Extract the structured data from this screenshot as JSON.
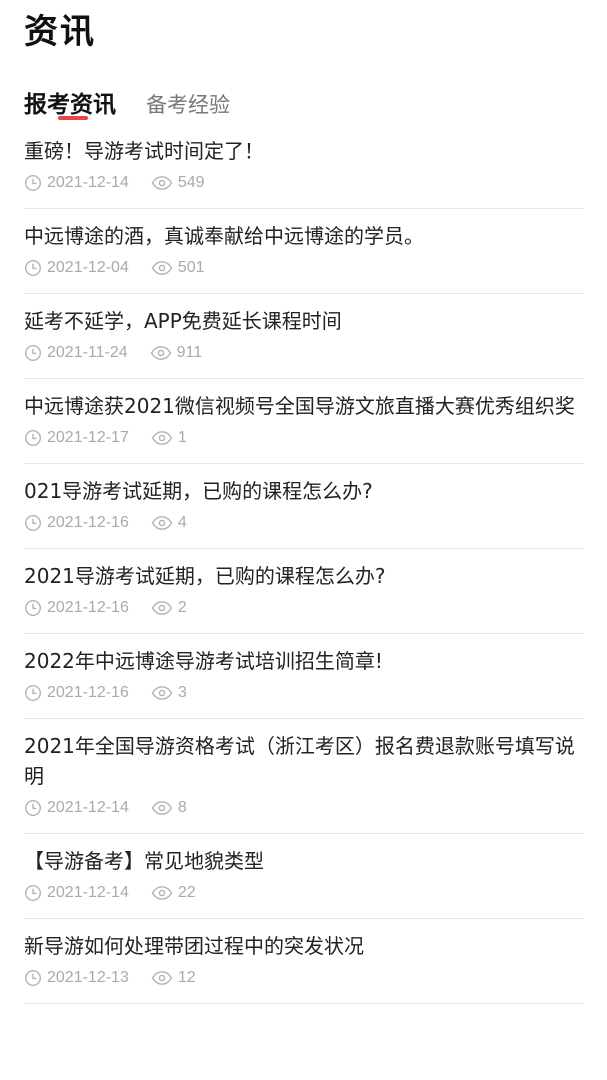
{
  "header": {
    "title": "资讯"
  },
  "tabs": [
    {
      "label": "报考资讯",
      "active": true
    },
    {
      "label": "备考经验",
      "active": false
    }
  ],
  "colors": {
    "accent": "#e8464a",
    "meta_text": "#aaaaaa",
    "divider": "#e8e8e8"
  },
  "icons": {
    "date": "clock-icon",
    "views": "eye-icon"
  },
  "news": [
    {
      "title": "重磅！导游考试时间定了！",
      "date": "2021-12-14",
      "views": "549"
    },
    {
      "title": "中远博途的酒，真诚奉献给中远博途的学员。",
      "date": "2021-12-04",
      "views": "501"
    },
    {
      "title": "延考不延学，APP免费延长课程时间",
      "date": "2021-11-24",
      "views": "911"
    },
    {
      "title": "中远博途获2021微信视频号全国导游文旅直播大赛优秀组织奖",
      "date": "2021-12-17",
      "views": "1"
    },
    {
      "title": "021导游考试延期，已购的课程怎么办?",
      "date": "2021-12-16",
      "views": "4"
    },
    {
      "title": "2021导游考试延期，已购的课程怎么办?",
      "date": "2021-12-16",
      "views": "2"
    },
    {
      "title": "2022年中远博途导游考试培训招生简章!",
      "date": "2021-12-16",
      "views": "3"
    },
    {
      "title": "2021年全国导游资格考试（浙江考区）报名费退款账号填写说明",
      "date": "2021-12-14",
      "views": "8"
    },
    {
      "title": "【导游备考】常见地貌类型",
      "date": "2021-12-14",
      "views": "22"
    },
    {
      "title": "新导游如何处理带团过程中的突发状况",
      "date": "2021-12-13",
      "views": "12"
    }
  ]
}
